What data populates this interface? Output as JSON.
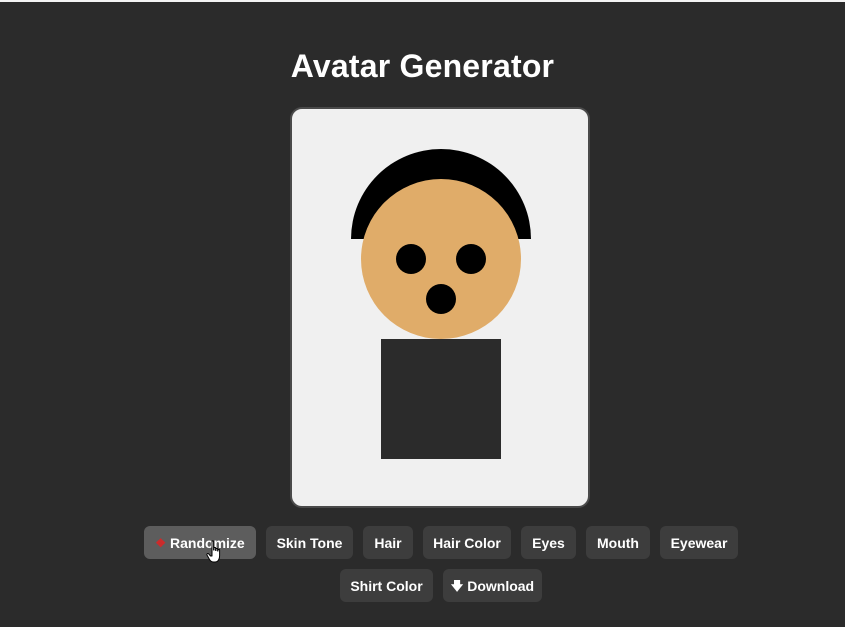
{
  "page": {
    "title": "Avatar Generator"
  },
  "avatar": {
    "background_color": "#f0f0f0",
    "skin_tone": "#e0ac69",
    "hair_color": "#000000",
    "eye_color": "#000000",
    "mouth_color": "#000000",
    "shirt_color": "#2b2b2b"
  },
  "controls": {
    "row1": [
      {
        "id": "randomize",
        "label": "Randomize",
        "icon": "dice-icon",
        "active": true
      },
      {
        "id": "skin-tone",
        "label": "Skin Tone"
      },
      {
        "id": "hair",
        "label": "Hair"
      },
      {
        "id": "hair-color",
        "label": "Hair Color"
      },
      {
        "id": "eyes",
        "label": "Eyes"
      },
      {
        "id": "mouth",
        "label": "Mouth"
      },
      {
        "id": "eyewear",
        "label": "Eyewear"
      }
    ],
    "row2": [
      {
        "id": "shirt-color",
        "label": "Shirt Color"
      },
      {
        "id": "download",
        "label": "Download",
        "icon": "download-arrow-icon"
      }
    ]
  }
}
